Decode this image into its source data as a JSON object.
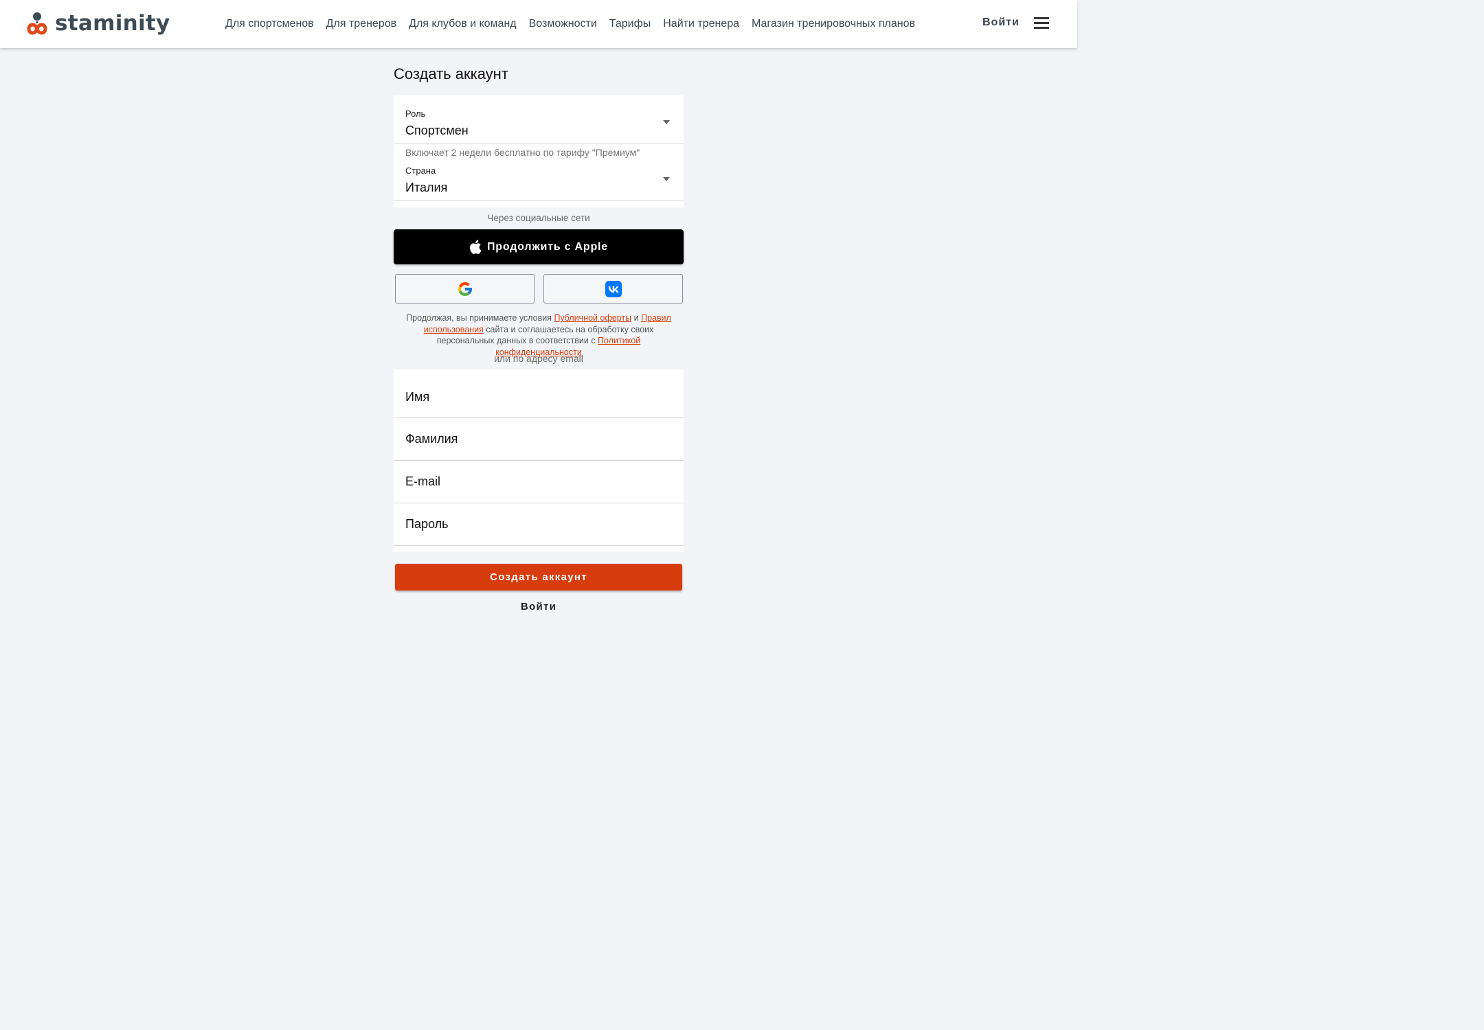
{
  "header": {
    "logo_text": "staminity",
    "nav": [
      {
        "label": "Для спортсменов"
      },
      {
        "label": "Для тренеров"
      },
      {
        "label": "Для клубов и команд"
      },
      {
        "label": "Возможности"
      },
      {
        "label": "Тарифы"
      },
      {
        "label": "Найти тренера"
      },
      {
        "label": "Магазин тренировочных планов"
      }
    ],
    "login_label": "Войти",
    "menu_icon": "hamburger-menu-icon"
  },
  "form": {
    "title": "Создать аккаунт",
    "role": {
      "label": "Роль",
      "value": "Спортсмен",
      "hint": "Включает 2 недели бесплатно по тарифу \"Премиум\""
    },
    "country": {
      "label": "Страна",
      "value": "Италия"
    },
    "social_caption": "Через социальные сети",
    "apple_button": "Продолжить с Apple",
    "google_icon": "google-icon",
    "vk_icon": "vk-icon",
    "terms": {
      "part1": "Продолжая, вы принимаете условия ",
      "link1": "Публичной оферты",
      "part2": " и ",
      "link2": "Правил использования",
      "part3": " сайта и соглашаетесь на обработку своих персональных данных в соответствии с ",
      "link3": "Политикой конфиденциальности"
    },
    "email_caption": "или по адресу email",
    "fields": {
      "first_name": {
        "placeholder": "Имя",
        "value": ""
      },
      "last_name": {
        "placeholder": "Фамилия",
        "value": ""
      },
      "email": {
        "placeholder": "E-mail",
        "value": ""
      },
      "password": {
        "placeholder": "Пароль",
        "value": ""
      }
    },
    "submit_label": "Создать аккаунт",
    "login_label": "Войти"
  },
  "colors": {
    "accent": "#d63c0e",
    "background": "#f3f4f7",
    "header_text": "#3c4650"
  }
}
